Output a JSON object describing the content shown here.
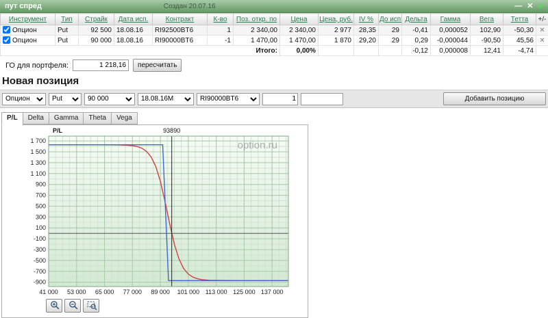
{
  "window": {
    "title": "пут спред",
    "created": "Создан 20.07.16",
    "minimize": "—",
    "close": "✕",
    "add": "+"
  },
  "table": {
    "headers": [
      "Инструмент",
      "Тип",
      "Страйк",
      "Дата исп.",
      "Контракт",
      "К-во",
      "Поз. откр. по",
      "Цена",
      "Цена, руб.",
      "IV %",
      "До исп.",
      "Дельта",
      "Гамма",
      "Вега",
      "Тетта"
    ],
    "plus_minus": "+/-",
    "delete_icon": "✕",
    "rows": [
      {
        "checked": true,
        "instrument": "Опцион",
        "type": "Put",
        "strike": "92 500",
        "expiry": "18.08.16",
        "contract": "RI92500BT6",
        "qty": "1",
        "pos_open": "2 340,00",
        "price": "2 340,00",
        "price_rub": "2 977",
        "iv": "28,35",
        "days": "29",
        "delta": "-0,41",
        "gamma": "0,000052",
        "vega": "102,90",
        "theta": "-50,30"
      },
      {
        "checked": true,
        "instrument": "Опцион",
        "type": "Put",
        "strike": "90 000",
        "expiry": "18.08.16",
        "contract": "RI90000BT6",
        "qty": "-1",
        "pos_open": "1 470,00",
        "price": "1 470,00",
        "price_rub": "1 870",
        "iv": "29,20",
        "days": "29",
        "delta": "0,29",
        "gamma": "-0,000044",
        "vega": "-90,50",
        "theta": "45,56"
      }
    ],
    "total": {
      "label": "Итого:",
      "pct": "0,00%",
      "delta": "-0,12",
      "gamma": "0,000008",
      "vega": "12,41",
      "theta": "-4,74"
    }
  },
  "portfolio": {
    "label": "ГО для портфеля:",
    "value": "1 218,16",
    "recalc_button": "пересчитать"
  },
  "new_position": {
    "heading": "Новая позиция",
    "selects": [
      {
        "name": "instrument",
        "value": "Опцион"
      },
      {
        "name": "type",
        "value": "Put"
      },
      {
        "name": "strike",
        "value": "90 000"
      },
      {
        "name": "expiry",
        "value": "18.08.16M"
      },
      {
        "name": "contract",
        "value": "RI90000BT6"
      }
    ],
    "qty_value": "1",
    "extra_value": "",
    "add_button": "Добавить позицию"
  },
  "tabs": [
    {
      "label": "P/L",
      "active": true
    },
    {
      "label": "Delta",
      "active": false
    },
    {
      "label": "Gamma",
      "active": false
    },
    {
      "label": "Theta",
      "active": false
    },
    {
      "label": "Vega",
      "active": false
    }
  ],
  "chart_data": {
    "type": "line",
    "ylabel": "P/L",
    "watermark": "option.ru",
    "xlim": [
      41000,
      144000
    ],
    "ylim": [
      -980,
      1790
    ],
    "x_ticks": [
      41000,
      53000,
      65000,
      77000,
      89000,
      101000,
      113000,
      125000,
      137000
    ],
    "x_tick_labels": [
      "41 000",
      "53 000",
      "65 000",
      "77 000",
      "89 000",
      "101 000",
      "113 000",
      "125 000",
      "137 000"
    ],
    "y_ticks": [
      1700,
      1500,
      1300,
      1100,
      900,
      700,
      500,
      300,
      100,
      -100,
      -300,
      -500,
      -700,
      -900
    ],
    "y_tick_labels": [
      "1 700",
      "1 500",
      "1 300",
      "1 100",
      "900",
      "700",
      "500",
      "300",
      "100",
      "-100",
      "-300",
      "-500",
      "-700",
      "-900"
    ],
    "grid": {
      "x_minor_step": 3000,
      "y_minor_step": 100
    },
    "zero_line": 0,
    "marker": {
      "x": 93890,
      "label": "93890"
    },
    "series": [
      {
        "name": "current-pl",
        "color": "#cf4040",
        "points": [
          [
            41000,
            1630
          ],
          [
            57000,
            1630
          ],
          [
            65000,
            1629
          ],
          [
            71000,
            1627
          ],
          [
            75000,
            1621
          ],
          [
            77000,
            1613
          ],
          [
            79000,
            1598
          ],
          [
            81000,
            1568
          ],
          [
            83000,
            1511
          ],
          [
            85000,
            1409
          ],
          [
            87000,
            1234
          ],
          [
            89000,
            958
          ],
          [
            91000,
            586
          ],
          [
            93000,
            174
          ],
          [
            95000,
            -198
          ],
          [
            97000,
            -473
          ],
          [
            99000,
            -649
          ],
          [
            101000,
            -751
          ],
          [
            103000,
            -808
          ],
          [
            105000,
            -838
          ],
          [
            107000,
            -853
          ],
          [
            110000,
            -864
          ],
          [
            115000,
            -868
          ],
          [
            125000,
            -870
          ],
          [
            144000,
            -870
          ]
        ]
      },
      {
        "name": "expiration-pl",
        "color": "#4166d8",
        "points": [
          [
            41000,
            1630
          ],
          [
            90000,
            1630
          ],
          [
            92500,
            -870
          ],
          [
            144000,
            -870
          ]
        ]
      }
    ]
  }
}
